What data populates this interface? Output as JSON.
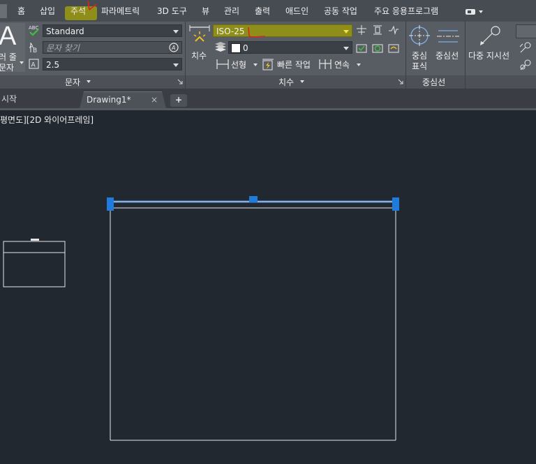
{
  "menu": {
    "items": [
      "홈",
      "삽입",
      "주석",
      "파라메트릭",
      "3D 도구",
      "뷰",
      "관리",
      "출력",
      "애드인",
      "공동 작업",
      "주요 응용프로그램"
    ]
  },
  "ribbon": {
    "text_panel": {
      "big_button_line1": "러 줄",
      "big_button_line2": "문자",
      "style_value": "Standard",
      "find_placeholder": "문자 찾기",
      "height_value": "2.5",
      "footer_label": "문자"
    },
    "dim_panel": {
      "dim_button_label": "치수",
      "style_value": "ISO-25",
      "layer_value": "0",
      "linear_label": "선형",
      "quick_label": "빠른 작업",
      "continue_label": "연속",
      "footer_label": "치수"
    },
    "center_panel": {
      "center_mark_line1": "중심",
      "center_mark_line2": "표식",
      "center_line_label": "중심선",
      "footer_label": "중심선"
    },
    "leader_panel": {
      "multileader_label": "다중 지시선"
    }
  },
  "tabs": {
    "start": "시작",
    "drawing": "Drawing1*",
    "add": "+"
  },
  "viewport": {
    "label": "평면도][2D 와이어프레임]"
  },
  "colors": {
    "highlight": "#8e8e18",
    "selection_grip": "#1f7bdc",
    "annotation_red": "#e02020"
  }
}
